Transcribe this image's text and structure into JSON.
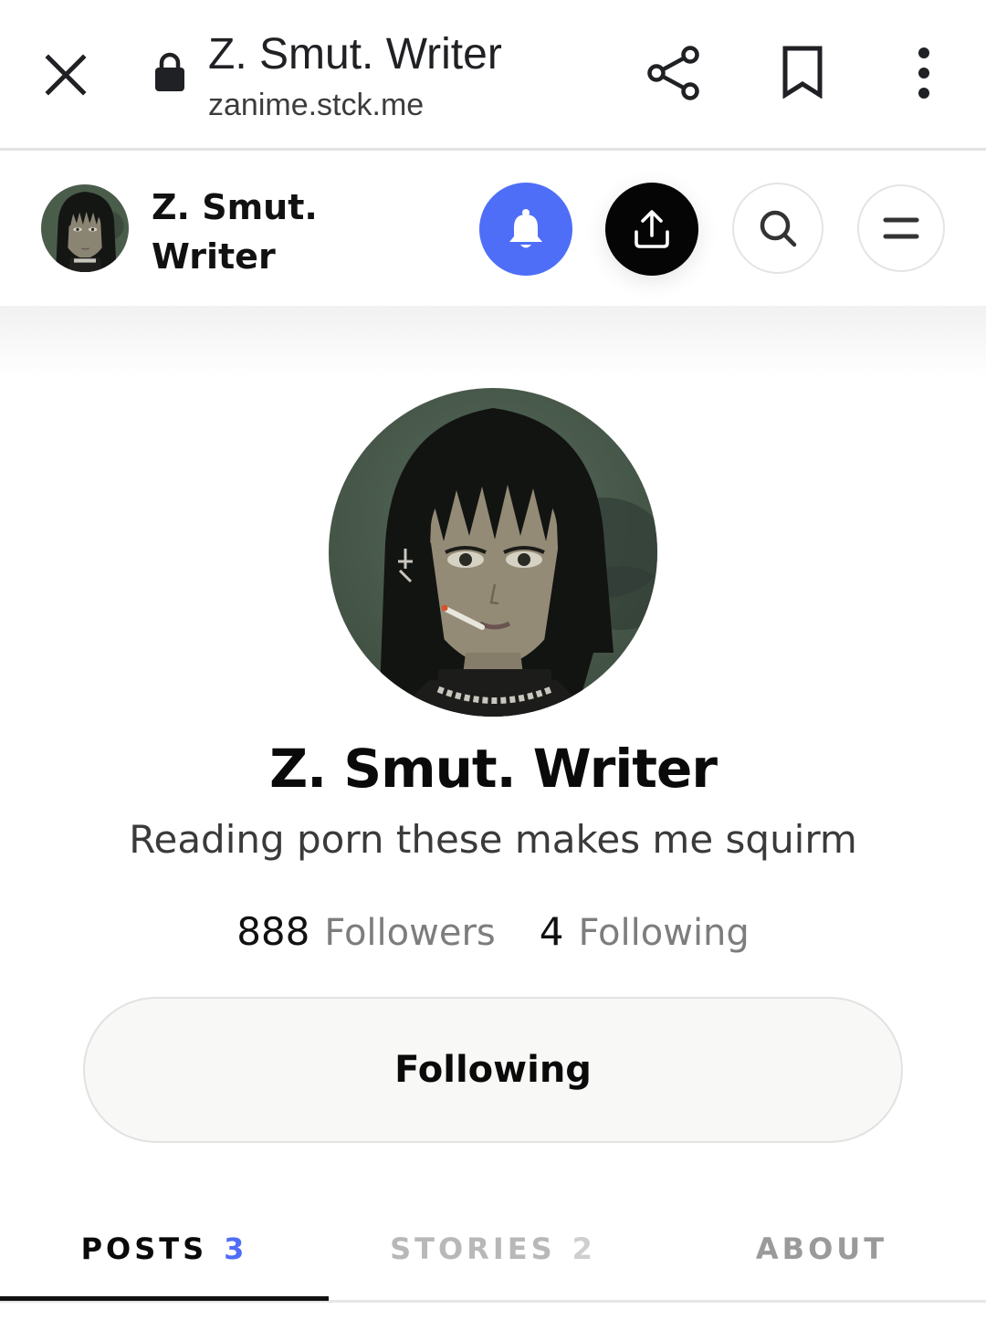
{
  "browser": {
    "title": "Z. Smut. Writer",
    "url": "zanime.stck.me",
    "icons": {
      "close": "close-icon",
      "lock": "lock-icon",
      "share": "share-icon",
      "bookmark": "bookmark-icon",
      "more": "more-vert-icon"
    }
  },
  "header": {
    "name": "Z. Smut. Writer",
    "accent_color": "#4f6ef7",
    "icons": {
      "bell": "bell-icon",
      "upload": "upload-share-icon",
      "search": "search-icon",
      "menu": "menu-icon"
    }
  },
  "profile": {
    "name": "Z. Smut. Writer",
    "bio": "Reading porn these makes me squirm",
    "followers_count": "888",
    "followers_label": "Followers",
    "following_count": "4",
    "following_label": "Following",
    "follow_button_label": "Following"
  },
  "tabs": [
    {
      "label": "POSTS",
      "count": "3",
      "active": true
    },
    {
      "label": "STORIES",
      "count": "2",
      "active": false
    },
    {
      "label": "ABOUT",
      "count": "",
      "active": false
    }
  ]
}
